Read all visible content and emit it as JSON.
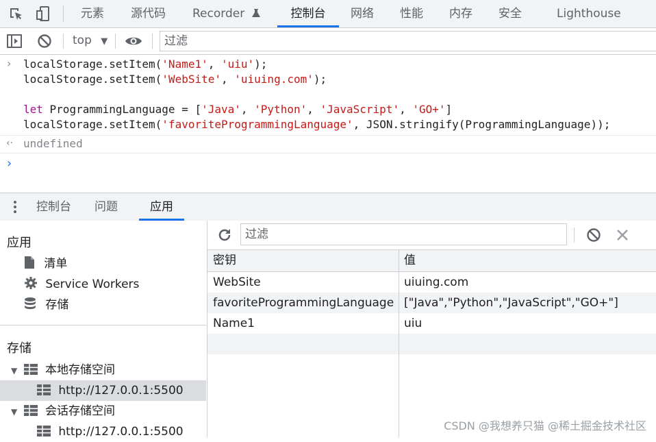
{
  "top_tabs": [
    "元素",
    "源代码",
    "Recorder",
    "控制台",
    "网络",
    "性能",
    "内存",
    "安全",
    "Lighthouse"
  ],
  "console_toolbar": {
    "context": "top",
    "filter_placeholder": "过滤"
  },
  "console": {
    "line1": {
      "pre": "localStorage.setItem(",
      "a": "'Name1'",
      "mid": ", ",
      "b": "'uiu'",
      "post": ");"
    },
    "line2": {
      "pre": "localStorage.setItem(",
      "a": "'WebSite'",
      "mid": ", ",
      "b": "'uiuing.com'",
      "post": ");"
    },
    "line4": {
      "kw": "let",
      "pre": " ProgrammingLanguage = [",
      "a": "'Java'",
      "s1": ", ",
      "b": "'Python'",
      "s2": ", ",
      "c": "'JavaScript'",
      "s3": ", ",
      "d": "'GO+'",
      "post": "]"
    },
    "line5": {
      "pre": "localStorage.setItem(",
      "a": "'favoriteProgrammingLanguage'",
      "post": ", JSON.stringify(ProgrammingLanguage));"
    },
    "result": "undefined"
  },
  "drawer_tabs": [
    "控制台",
    "问题",
    "应用"
  ],
  "sidebar": {
    "app_header": "应用",
    "app_items": [
      "清单",
      "Service Workers",
      "存储"
    ],
    "storage_header": "存储",
    "local_storage": "本地存储空间",
    "local_origin": "http://127.0.0.1:5500",
    "session_storage": "会话存储空间",
    "session_origin": "http://127.0.0.1:5500"
  },
  "storage_panel": {
    "filter_placeholder": "过滤",
    "columns": [
      "密钥",
      "值"
    ],
    "rows": [
      {
        "key": "WebSite",
        "value": "uiuing.com"
      },
      {
        "key": "favoriteProgrammingLanguage",
        "value": "[\"Java\",\"Python\",\"JavaScript\",\"GO+\"]"
      },
      {
        "key": "Name1",
        "value": "uiu"
      }
    ]
  },
  "watermark": "CSDN @我想养只猫 @稀土掘金技术社区"
}
